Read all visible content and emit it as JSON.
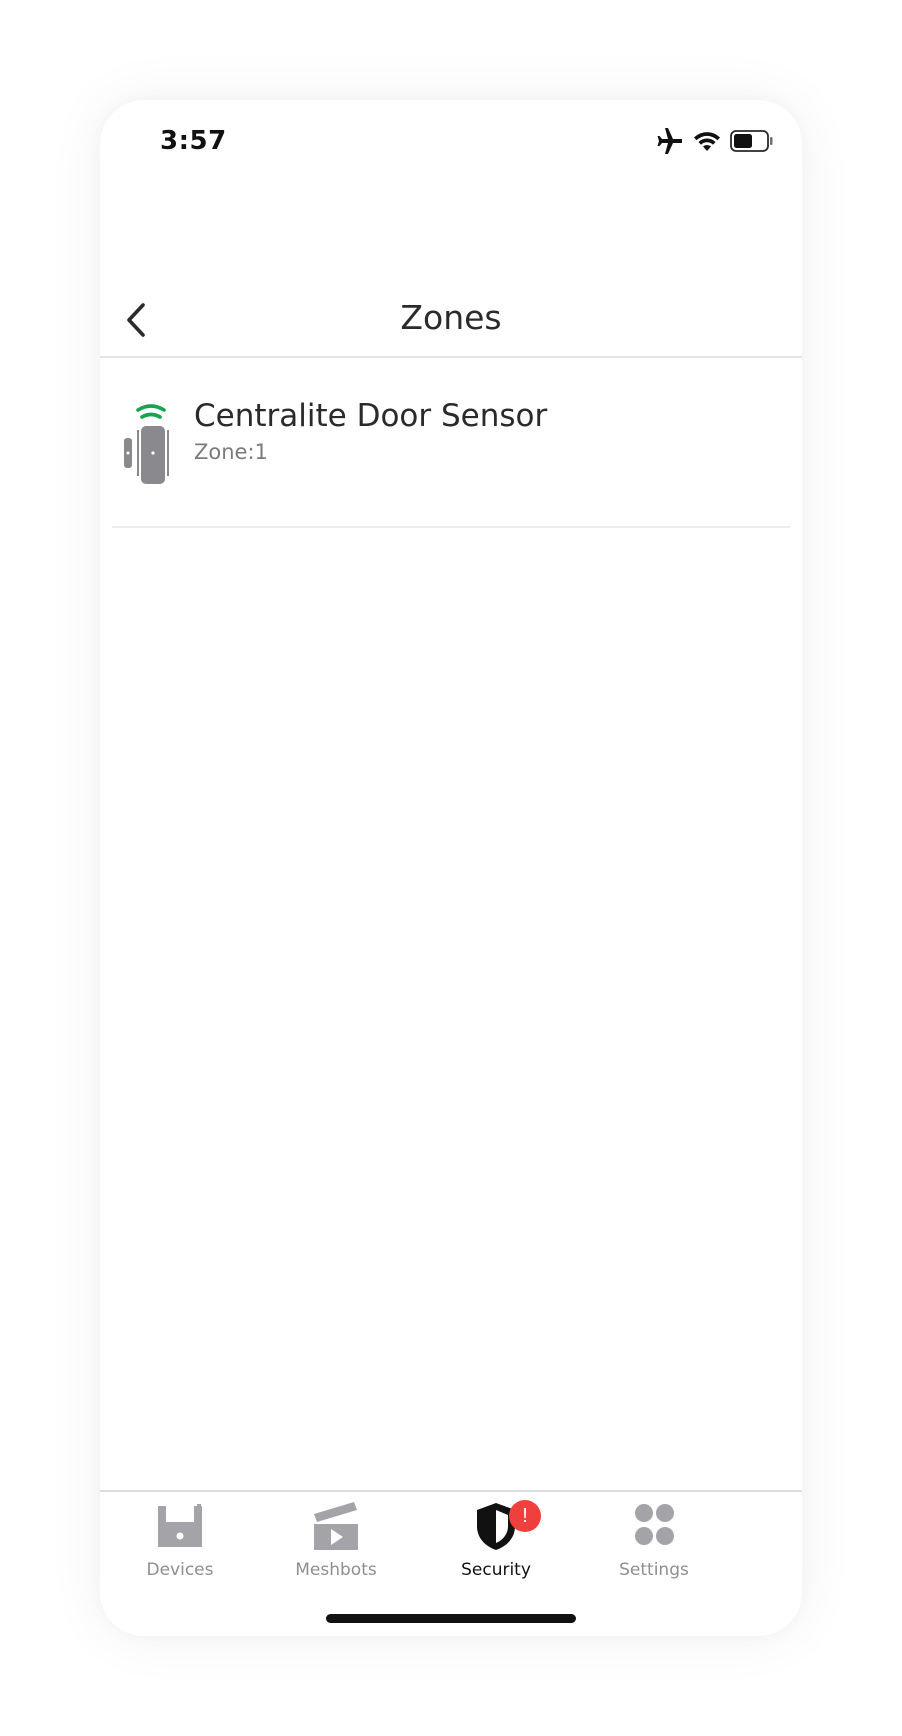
{
  "status_bar": {
    "time": "3:57",
    "icons": [
      "airplane-icon",
      "wifi-icon",
      "battery-icon"
    ]
  },
  "header": {
    "title": "Zones",
    "back_icon": "chevron-left-icon"
  },
  "zones": [
    {
      "name": "Centralite Door Sensor",
      "subtitle": "Zone:1",
      "icon": "door-sensor-icon",
      "signal_color": "#1aa251"
    }
  ],
  "tabs": [
    {
      "label": "Devices",
      "icon": "devices-icon",
      "active": false
    },
    {
      "label": "Meshbots",
      "icon": "meshbots-icon",
      "active": false
    },
    {
      "label": "Security",
      "icon": "security-shield-icon",
      "active": true,
      "badge": "!"
    },
    {
      "label": "Settings",
      "icon": "settings-grid-icon",
      "active": false
    }
  ],
  "colors": {
    "accent_alert": "#f0403e",
    "inactive_tab": "#8e8e93",
    "icon_gray": "#8a8a8e",
    "signal_green": "#1aa251"
  }
}
